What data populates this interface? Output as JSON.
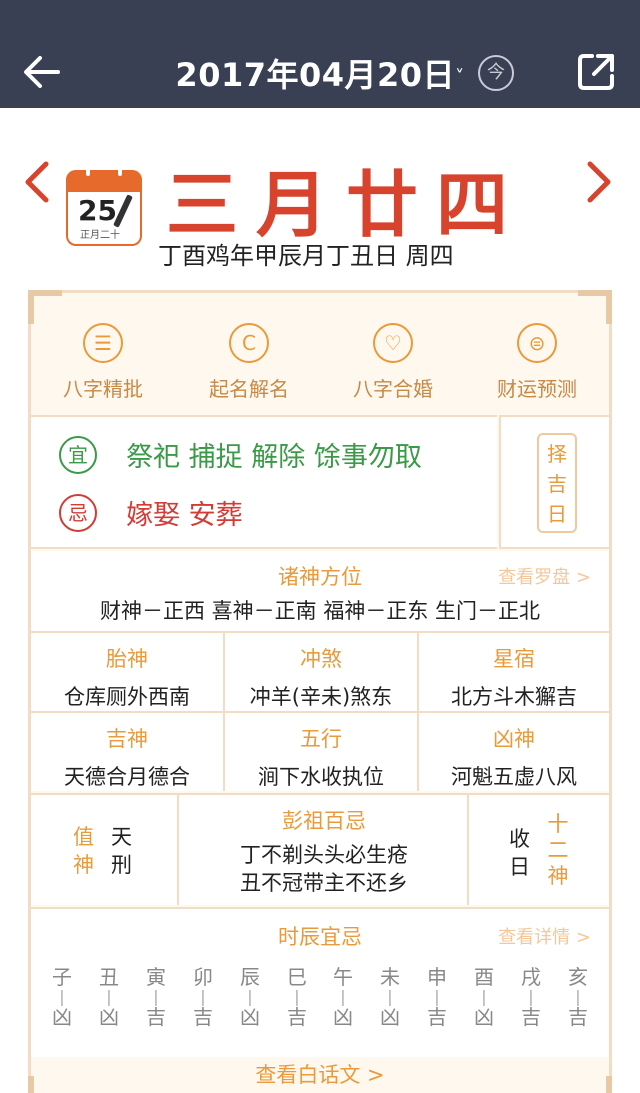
{
  "header": {
    "date": "2017年04月20日",
    "date_caret": "˅",
    "today_label": "今"
  },
  "day": {
    "calendar_icon_day": "25",
    "calendar_icon_lunar": "正月二十",
    "lunar_date": "三月廿四",
    "ganzhi": "丁酉鸡年甲辰月丁丑日 周四"
  },
  "tools": [
    {
      "label": "八字精批",
      "icon": "☰"
    },
    {
      "label": "起名解名",
      "icon": "C"
    },
    {
      "label": "八字合婚",
      "icon": "♡"
    },
    {
      "label": "财运预测",
      "icon": "⊜"
    }
  ],
  "yiji": {
    "yi_seal": "宜",
    "yi_text": "祭祀 捕捉 解除 馀事勿取",
    "ji_seal": "忌",
    "ji_text": "嫁娶 安葬",
    "choose_label": [
      "择",
      "吉",
      "日"
    ]
  },
  "zhushen": {
    "title": "诸神方位",
    "more": "查看罗盘 >",
    "line": "财神－正西   喜神－正南   福神－正东   生门－正北"
  },
  "row1": [
    {
      "h": "胎神",
      "v": "仓库厕外西南"
    },
    {
      "h": "冲煞",
      "v": "冲羊(辛未)煞东"
    },
    {
      "h": "星宿",
      "v": "北方斗木獬吉"
    }
  ],
  "row2": [
    {
      "h": "吉神",
      "v": "天德合月德合"
    },
    {
      "h": "五行",
      "v": "涧下水收执位"
    },
    {
      "h": "凶神",
      "v": "河魁五虚八风"
    }
  ],
  "pengzu": {
    "zhishen_h": "值神",
    "zhishen_v": "天刑",
    "title": "彭祖百忌",
    "line1": "丁不剃头头必生疮",
    "line2": "丑不冠带主不还乡",
    "shou_h": "收日",
    "shou_v": "十二神"
  },
  "shichen": {
    "title": "时辰宜忌",
    "more": "查看详情 >",
    "hours": [
      {
        "b": "子",
        "r": "凶"
      },
      {
        "b": "丑",
        "r": "凶"
      },
      {
        "b": "寅",
        "r": "吉"
      },
      {
        "b": "卯",
        "r": "吉"
      },
      {
        "b": "辰",
        "r": "凶"
      },
      {
        "b": "巳",
        "r": "吉"
      },
      {
        "b": "午",
        "r": "凶"
      },
      {
        "b": "未",
        "r": "凶"
      },
      {
        "b": "申",
        "r": "吉"
      },
      {
        "b": "酉",
        "r": "凶"
      },
      {
        "b": "戌",
        "r": "吉"
      },
      {
        "b": "亥",
        "r": "吉"
      }
    ]
  },
  "footer": {
    "vernacular": "查看白话文 >"
  },
  "colors": {
    "header_bg": "#3a4054",
    "lunar_red": "#d7432d",
    "accent_orange": "#e99a3a",
    "yi_green": "#3a9a47",
    "ji_red": "#d33b35"
  }
}
